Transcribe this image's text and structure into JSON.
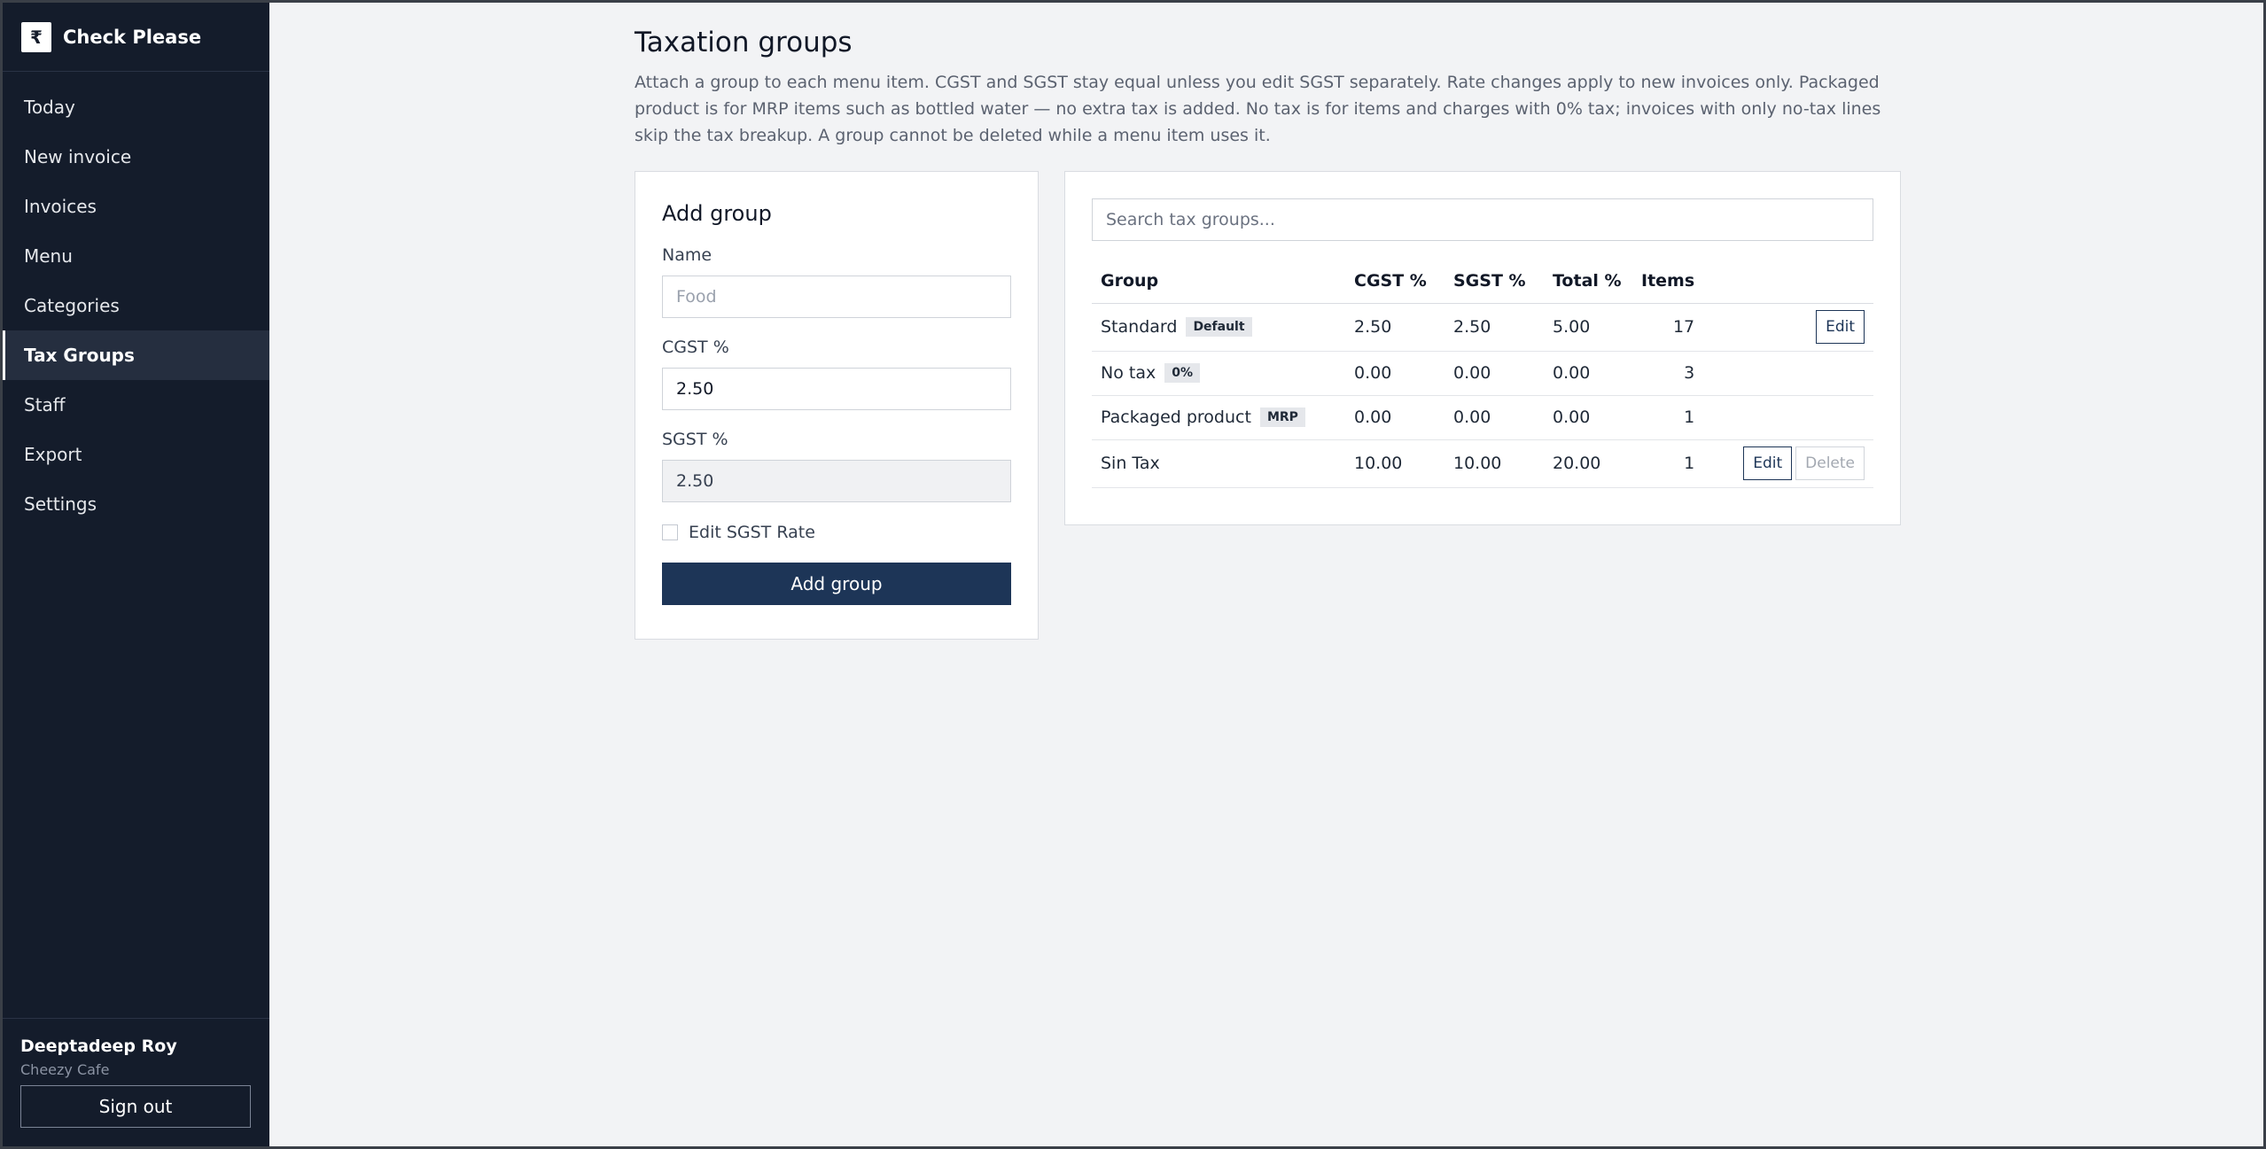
{
  "sidebar": {
    "brand_icon": "₹",
    "brand_name": "Check Please",
    "items": [
      {
        "label": "Today"
      },
      {
        "label": "New invoice"
      },
      {
        "label": "Invoices"
      },
      {
        "label": "Menu"
      },
      {
        "label": "Categories"
      },
      {
        "label": "Tax Groups",
        "active": true
      },
      {
        "label": "Staff"
      },
      {
        "label": "Export"
      },
      {
        "label": "Settings"
      }
    ],
    "user_name": "Deeptadeep Roy",
    "user_org": "Cheezy Cafe",
    "signout_label": "Sign out"
  },
  "page": {
    "title": "Taxation groups",
    "description": "Attach a group to each menu item. CGST and SGST stay equal unless you edit SGST separately. Rate changes apply to new invoices only. Packaged product is for MRP items such as bottled water — no extra tax is added. No tax is for items and charges with 0% tax; invoices with only no-tax lines skip the tax breakup. A group cannot be deleted while a menu item uses it."
  },
  "add_form": {
    "title": "Add group",
    "name_label": "Name",
    "name_placeholder": "Food",
    "cgst_label": "CGST %",
    "cgst_value": "2.50",
    "sgst_label": "SGST %",
    "sgst_value": "2.50",
    "edit_sgst_label": "Edit SGST Rate",
    "submit_label": "Add group"
  },
  "list": {
    "search_placeholder": "Search tax groups...",
    "headers": {
      "group": "Group",
      "cgst": "CGST %",
      "sgst": "SGST %",
      "total": "Total %",
      "items": "Items"
    },
    "rows": [
      {
        "name": "Standard",
        "badge": "Default",
        "cgst": "2.50",
        "sgst": "2.50",
        "total": "5.00",
        "items": "17",
        "edit": "Edit"
      },
      {
        "name": "No tax",
        "badge": "0%",
        "cgst": "0.00",
        "sgst": "0.00",
        "total": "0.00",
        "items": "3"
      },
      {
        "name": "Packaged product",
        "badge": "MRP",
        "cgst": "0.00",
        "sgst": "0.00",
        "total": "0.00",
        "items": "1"
      },
      {
        "name": "Sin Tax",
        "cgst": "10.00",
        "sgst": "10.00",
        "total": "20.00",
        "items": "1",
        "edit": "Edit",
        "delete": "Delete"
      }
    ]
  },
  "colors": {
    "sidebar_bg": "#141c2b",
    "primary": "#1d3557",
    "page_bg": "#f2f3f5"
  }
}
